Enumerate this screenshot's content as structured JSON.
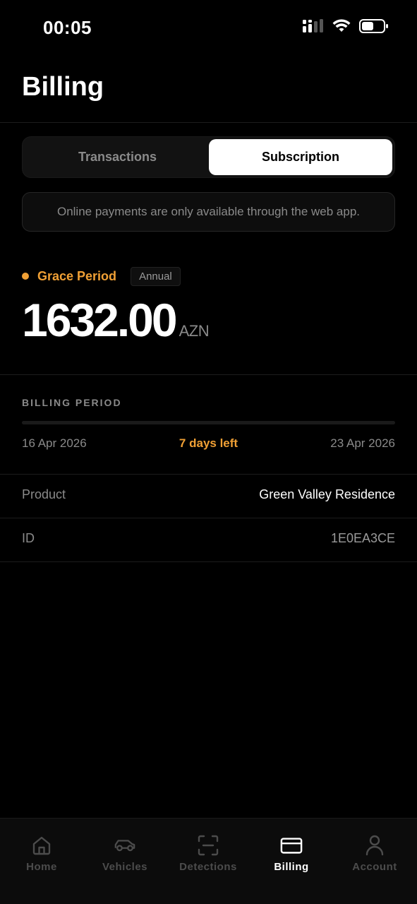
{
  "status_bar": {
    "time": "00:05"
  },
  "header": {
    "title": "Billing"
  },
  "segmented": {
    "tabs": [
      {
        "label": "Transactions"
      },
      {
        "label": "Subscription"
      }
    ],
    "selected": "Subscription"
  },
  "notice": {
    "text": "Online payments are only available through the web app."
  },
  "subscription": {
    "status": "Grace Period",
    "plan": "Annual",
    "amount": "1632.00",
    "currency": "AZN"
  },
  "billing_period": {
    "label": "BILLING PERIOD",
    "start": "16 Apr 2026",
    "remaining": "7 days left",
    "end": "23 Apr 2026",
    "progress": 0
  },
  "details": [
    {
      "key": "Product",
      "value": "Green Valley Residence"
    },
    {
      "key": "ID",
      "value": "1E0EA3CE"
    }
  ],
  "tabbar": {
    "items": [
      {
        "label": "Home",
        "icon": "home-icon"
      },
      {
        "label": "Vehicles",
        "icon": "car-icon"
      },
      {
        "label": "Detections",
        "icon": "scan-icon"
      },
      {
        "label": "Billing",
        "icon": "credit-card-icon"
      },
      {
        "label": "Account",
        "icon": "user-icon"
      }
    ],
    "active": "Billing"
  },
  "colors": {
    "accent": "#f0a035",
    "background": "#000000",
    "muted": "#8a8a8a"
  }
}
